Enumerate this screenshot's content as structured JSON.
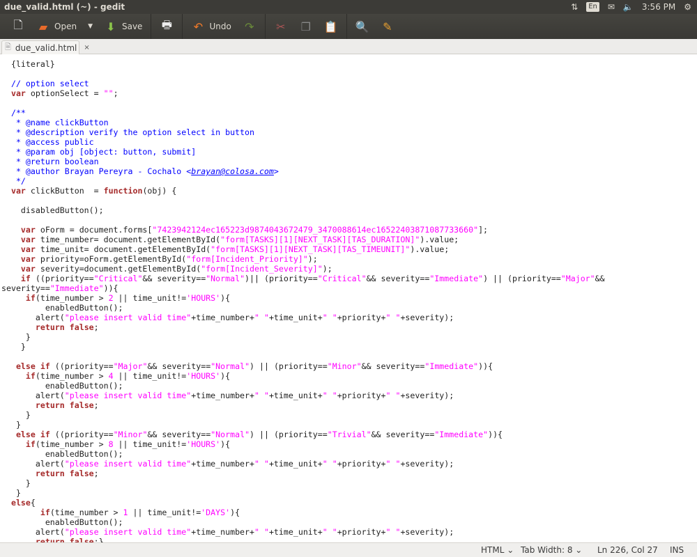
{
  "window": {
    "title": "due_valid.html (~) - gedit"
  },
  "indicators": {
    "language": "En",
    "time": "3:56 PM"
  },
  "toolbar": {
    "open": "Open",
    "save": "Save",
    "undo": "Undo"
  },
  "tab": {
    "label": "due_valid.html",
    "close": "×"
  },
  "status": {
    "language": "HTML ⌄",
    "tab_width": "Tab Width: 8 ⌄",
    "position": "Ln 226, Col 27",
    "mode": "INS"
  },
  "code": [
    [
      [
        "p",
        "  {literal}"
      ]
    ],
    [],
    [
      [
        "c",
        "  // option select"
      ]
    ],
    [
      [
        "p",
        "  "
      ],
      [
        "k",
        "var"
      ],
      [
        "p",
        " optionSelect = "
      ],
      [
        "s",
        "\"\""
      ],
      [
        "p",
        ";"
      ]
    ],
    [],
    [
      [
        "c",
        "  /**"
      ]
    ],
    [
      [
        "c",
        "   * @name clickButton"
      ]
    ],
    [
      [
        "c",
        "   * @description verify the option select in button"
      ]
    ],
    [
      [
        "c",
        "   * @access public"
      ]
    ],
    [
      [
        "c",
        "   * @param obj [object: button, submit]"
      ]
    ],
    [
      [
        "c",
        "   * @return boolean"
      ]
    ],
    [
      [
        "c",
        "   * @author Brayan Pereyra - Cochalo <"
      ],
      [
        "u",
        "brayan@colosa.com"
      ],
      [
        "c",
        ">"
      ]
    ],
    [
      [
        "c",
        "   */"
      ]
    ],
    [
      [
        "p",
        "  "
      ],
      [
        "k",
        "var"
      ],
      [
        "p",
        " clickButton  = "
      ],
      [
        "k",
        "function"
      ],
      [
        "p",
        "(obj) {"
      ]
    ],
    [],
    [
      [
        "p",
        "    disabledButton();"
      ]
    ],
    [],
    [
      [
        "p",
        "    "
      ],
      [
        "k",
        "var"
      ],
      [
        "p",
        " oForm = document.forms["
      ],
      [
        "s",
        "\"7423942124ec165223d9874043672479_3470088614ec16522403871087733660\""
      ],
      [
        "p",
        "];"
      ]
    ],
    [
      [
        "p",
        "    "
      ],
      [
        "k",
        "var"
      ],
      [
        "p",
        " time_number= document.getElementById("
      ],
      [
        "s",
        "\"form[TASKS][1][NEXT_TASK][TAS_DURATION]\""
      ],
      [
        "p",
        ").value;"
      ]
    ],
    [
      [
        "p",
        "    "
      ],
      [
        "k",
        "var"
      ],
      [
        "p",
        " time_unit= document.getElementById("
      ],
      [
        "s",
        "\"form[TASKS][1][NEXT_TASK][TAS_TIMEUNIT]\""
      ],
      [
        "p",
        ").value;"
      ]
    ],
    [
      [
        "p",
        "    "
      ],
      [
        "k",
        "var"
      ],
      [
        "p",
        " priority=oForm.getElementById("
      ],
      [
        "s",
        "\"form[Incident_Priority]\""
      ],
      [
        "p",
        ");"
      ]
    ],
    [
      [
        "p",
        "    "
      ],
      [
        "k",
        "var"
      ],
      [
        "p",
        " severity=document.getElementById("
      ],
      [
        "s",
        "\"form[Incident_Severity]\""
      ],
      [
        "p",
        ");"
      ]
    ],
    [
      [
        "p",
        "    "
      ],
      [
        "k",
        "if"
      ],
      [
        "p",
        " ((priority=="
      ],
      [
        "s",
        "\"Critical\""
      ],
      [
        "p",
        "&& severity=="
      ],
      [
        "s",
        "\"Normal\""
      ],
      [
        "p",
        ")|| (priority=="
      ],
      [
        "s",
        "\"Critical\""
      ],
      [
        "p",
        "&& severity=="
      ],
      [
        "s",
        "\"Immediate\""
      ],
      [
        "p",
        ") || (priority=="
      ],
      [
        "s",
        "\"Major\""
      ],
      [
        "p",
        "&& severity=="
      ],
      [
        "s",
        "\"Immediate\""
      ],
      [
        "p",
        ")){"
      ]
    ],
    [
      [
        "p",
        "     "
      ],
      [
        "k",
        "if"
      ],
      [
        "p",
        "(time_number > "
      ],
      [
        "s",
        "2"
      ],
      [
        "p",
        " || time_unit!="
      ],
      [
        "s",
        "'HOURS'"
      ],
      [
        "p",
        "){"
      ]
    ],
    [
      [
        "p",
        "         enabledButton();"
      ]
    ],
    [
      [
        "p",
        "       alert("
      ],
      [
        "s",
        "\"please insert valid time\""
      ],
      [
        "p",
        "+time_number+"
      ],
      [
        "s",
        "\" \""
      ],
      [
        "p",
        "+time_unit+"
      ],
      [
        "s",
        "\" \""
      ],
      [
        "p",
        "+priority+"
      ],
      [
        "s",
        "\" \""
      ],
      [
        "p",
        "+severity);"
      ]
    ],
    [
      [
        "p",
        "       "
      ],
      [
        "k",
        "return"
      ],
      [
        "p",
        " "
      ],
      [
        "k",
        "false"
      ],
      [
        "p",
        ";"
      ]
    ],
    [
      [
        "p",
        "     }"
      ]
    ],
    [
      [
        "p",
        "    }"
      ]
    ],
    [],
    [
      [
        "p",
        "   "
      ],
      [
        "k",
        "else"
      ],
      [
        "p",
        " "
      ],
      [
        "k",
        "if"
      ],
      [
        "p",
        " ((priority=="
      ],
      [
        "s",
        "\"Major\""
      ],
      [
        "p",
        "&& severity=="
      ],
      [
        "s",
        "\"Normal\""
      ],
      [
        "p",
        ") || (priority=="
      ],
      [
        "s",
        "\"Minor\""
      ],
      [
        "p",
        "&& severity=="
      ],
      [
        "s",
        "\"Immediate\""
      ],
      [
        "p",
        ")){"
      ]
    ],
    [
      [
        "p",
        "     "
      ],
      [
        "k",
        "if"
      ],
      [
        "p",
        "(time_number > "
      ],
      [
        "s",
        "4"
      ],
      [
        "p",
        " || time_unit!="
      ],
      [
        "s",
        "'HOURS'"
      ],
      [
        "p",
        "){"
      ]
    ],
    [
      [
        "p",
        "         enabledButton();"
      ]
    ],
    [
      [
        "p",
        "       alert("
      ],
      [
        "s",
        "\"please insert valid time\""
      ],
      [
        "p",
        "+time_number+"
      ],
      [
        "s",
        "\" \""
      ],
      [
        "p",
        "+time_unit+"
      ],
      [
        "s",
        "\" \""
      ],
      [
        "p",
        "+priority+"
      ],
      [
        "s",
        "\" \""
      ],
      [
        "p",
        "+severity);"
      ]
    ],
    [
      [
        "p",
        "       "
      ],
      [
        "k",
        "return"
      ],
      [
        "p",
        " "
      ],
      [
        "k",
        "false"
      ],
      [
        "p",
        ";"
      ]
    ],
    [
      [
        "p",
        "     }"
      ]
    ],
    [
      [
        "p",
        "   }"
      ]
    ],
    [
      [
        "p",
        "   "
      ],
      [
        "k",
        "else"
      ],
      [
        "p",
        " "
      ],
      [
        "k",
        "if"
      ],
      [
        "p",
        " ((priority=="
      ],
      [
        "s",
        "\"Minor\""
      ],
      [
        "p",
        "&& severity=="
      ],
      [
        "s",
        "\"Normal\""
      ],
      [
        "p",
        ") || (priority=="
      ],
      [
        "s",
        "\"Trivial\""
      ],
      [
        "p",
        "&& severity=="
      ],
      [
        "s",
        "\"Immediate\""
      ],
      [
        "p",
        ")){"
      ]
    ],
    [
      [
        "p",
        "     "
      ],
      [
        "k",
        "if"
      ],
      [
        "p",
        "(time_number > "
      ],
      [
        "s",
        "8"
      ],
      [
        "p",
        " || time_unit!="
      ],
      [
        "s",
        "'HOURS'"
      ],
      [
        "p",
        "){"
      ]
    ],
    [
      [
        "p",
        "         enabledButton();"
      ]
    ],
    [
      [
        "p",
        "       alert("
      ],
      [
        "s",
        "\"please insert valid time\""
      ],
      [
        "p",
        "+time_number+"
      ],
      [
        "s",
        "\" \""
      ],
      [
        "p",
        "+time_unit+"
      ],
      [
        "s",
        "\" \""
      ],
      [
        "p",
        "+priority+"
      ],
      [
        "s",
        "\" \""
      ],
      [
        "p",
        "+severity);"
      ]
    ],
    [
      [
        "p",
        "       "
      ],
      [
        "k",
        "return"
      ],
      [
        "p",
        " "
      ],
      [
        "k",
        "false"
      ],
      [
        "p",
        ";"
      ]
    ],
    [
      [
        "p",
        "     }"
      ]
    ],
    [
      [
        "p",
        "   }"
      ]
    ],
    [
      [
        "p",
        "  "
      ],
      [
        "k",
        "else"
      ],
      [
        "p",
        "{"
      ]
    ],
    [
      [
        "p",
        "        "
      ],
      [
        "k",
        "if"
      ],
      [
        "p",
        "(time_number > "
      ],
      [
        "s",
        "1"
      ],
      [
        "p",
        " || time_unit!="
      ],
      [
        "s",
        "'DAYS'"
      ],
      [
        "p",
        "){"
      ]
    ],
    [
      [
        "p",
        "         enabledButton();"
      ]
    ],
    [
      [
        "p",
        "       alert("
      ],
      [
        "s",
        "\"please insert valid time\""
      ],
      [
        "p",
        "+time_number+"
      ],
      [
        "s",
        "\" \""
      ],
      [
        "p",
        "+time_unit+"
      ],
      [
        "s",
        "\" \""
      ],
      [
        "p",
        "+priority+"
      ],
      [
        "s",
        "\" \""
      ],
      [
        "p",
        "+severity);"
      ]
    ],
    [
      [
        "p",
        "       "
      ],
      [
        "k",
        "return"
      ],
      [
        "p",
        " "
      ],
      [
        "k",
        "false"
      ],
      [
        "p",
        ";}"
      ]
    ]
  ]
}
